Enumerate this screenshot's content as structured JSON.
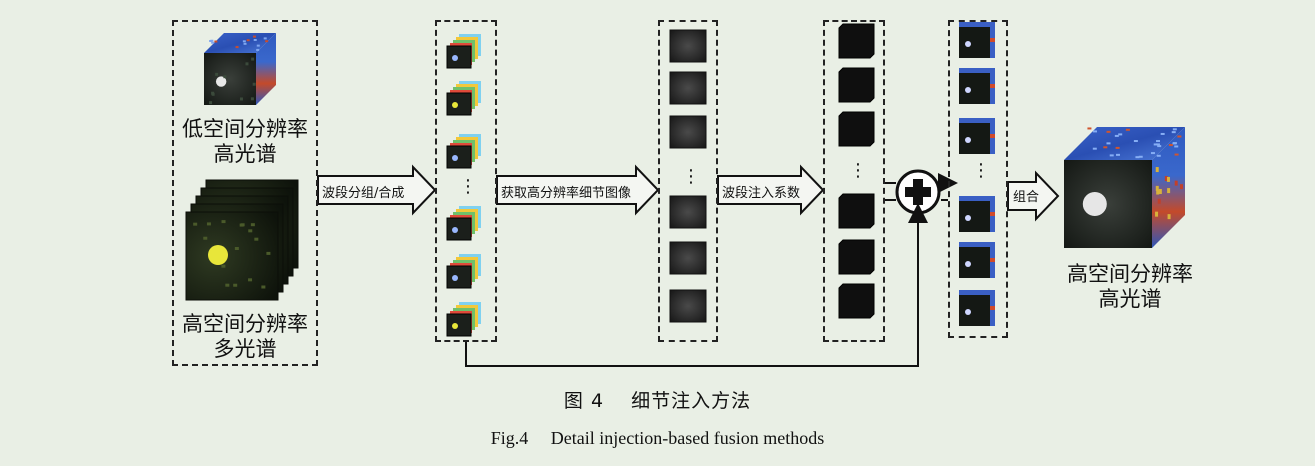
{
  "labels": {
    "lowres_hs_line1": "低空间分辨率",
    "lowres_hs_line2": "高光谱",
    "highres_ms_line1": "高空间分辨率",
    "highres_ms_line2": "多光谱",
    "output_line1": "高空间分辨率",
    "output_line2": "高光谱"
  },
  "arrows": {
    "band_group": "波段分组/合成",
    "extract_detail": "获取高分辨率细节图像",
    "injection_coef": "波段注入系数",
    "combine": "组合"
  },
  "ellipsis": "⋮",
  "caption": {
    "cn": "图 4　 细节注入方法",
    "en": "Fig.4　 Detail injection-based fusion methods"
  }
}
